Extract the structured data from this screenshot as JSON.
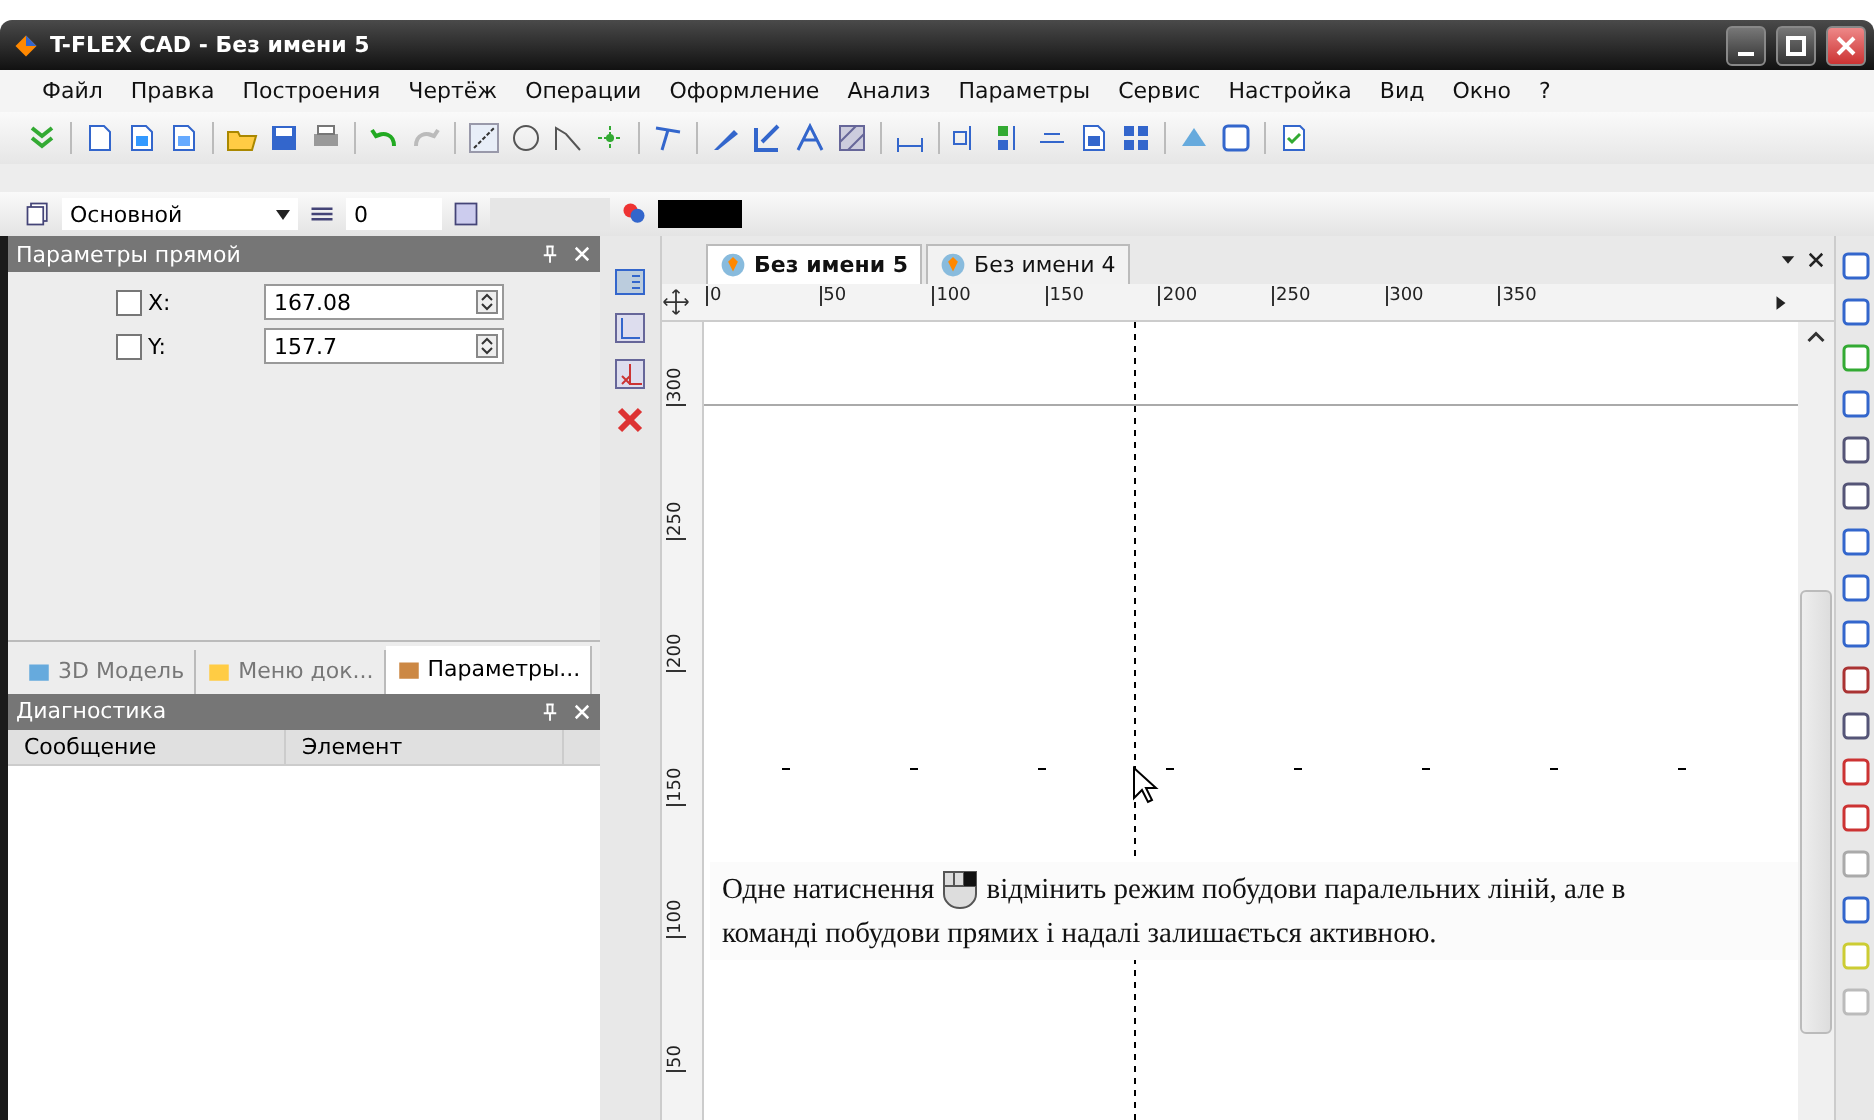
{
  "window": {
    "title": "T-FLEX CAD - Без имени 5"
  },
  "menu": [
    "Файл",
    "Правка",
    "Построения",
    "Чертёж",
    "Операции",
    "Оформление",
    "Анализ",
    "Параметры",
    "Сервис",
    "Настройка",
    "Вид",
    "Окно",
    "?"
  ],
  "layer_bar": {
    "layer": "Основной",
    "level": "0"
  },
  "params_panel": {
    "title": "Параметры прямой",
    "fields": [
      {
        "label": "X:",
        "value": "167.08",
        "checked": false
      },
      {
        "label": "Y:",
        "value": "157.7",
        "checked": false
      }
    ]
  },
  "panel_tabs": [
    {
      "label": "3D Модель",
      "selected": false
    },
    {
      "label": "Меню док...",
      "selected": false
    },
    {
      "label": "Параметры...",
      "selected": true
    }
  ],
  "diagnostics": {
    "title": "Диагностика",
    "columns": [
      "Сообщение",
      "Элемент"
    ]
  },
  "document_tabs": [
    {
      "label": "Без имени 5",
      "selected": true
    },
    {
      "label": "Без имени 4",
      "selected": false
    }
  ],
  "ruler": {
    "x_labels": [
      "0",
      "50",
      "100",
      "150",
      "200",
      "250",
      "300",
      "350"
    ],
    "y_labels": [
      "300",
      "250",
      "200",
      "150",
      "100",
      "50"
    ]
  },
  "note": {
    "before_icon": "Одне натиснення",
    "after_icon": "відмінить режим побудови паралельних ліній, але в",
    "second_line": "команді побудови прямих і надалі залишається активною."
  }
}
